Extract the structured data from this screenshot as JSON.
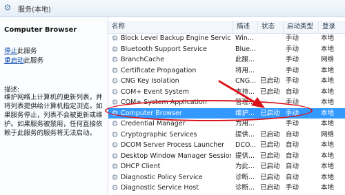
{
  "window": {
    "title": "服务(本地)"
  },
  "left_pane": {
    "service_name": "Computer Browser",
    "stop_link": "停止",
    "stop_suffix": "此服务",
    "restart_link": "重启动",
    "restart_suffix": "此服务",
    "description_label": "描述:",
    "description": "维护网络上计算机的更新列表，并将列表提供给计算机指定浏览。如果服务停止，列表不会被更新或维护。如果服务被禁用，任何直接依赖于此服务的服务将无法启动。"
  },
  "columns": [
    "名称",
    "描述",
    "状态",
    "启动类型",
    "登录"
  ],
  "rows": [
    {
      "name": "Block Level Backup Engine Service",
      "desc": "Win...",
      "status": "",
      "startup": "手动",
      "logon": "本地"
    },
    {
      "name": "Bluetooth Support Service",
      "desc": "Blue...",
      "status": "",
      "startup": "手动",
      "logon": "本地"
    },
    {
      "name": "BranchCache",
      "desc": "此服...",
      "status": "",
      "startup": "手动",
      "logon": "网络"
    },
    {
      "name": "Certificate Propagation",
      "desc": "将用...",
      "status": "",
      "startup": "手动",
      "logon": "本地"
    },
    {
      "name": "CNG Key Isolation",
      "desc": "CNG...",
      "status": "已启动",
      "startup": "手动",
      "logon": "本地"
    },
    {
      "name": "COM+ Event System",
      "desc": "支持...",
      "status": "已启动",
      "startup": "自动",
      "logon": "本地"
    },
    {
      "name": "COM+ System Application",
      "desc": "管理...",
      "status": "",
      "startup": "手动",
      "logon": "本地"
    },
    {
      "name": "Computer Browser",
      "desc": "维护...",
      "status": "已启动",
      "startup": "手动",
      "logon": "本地",
      "selected": true
    },
    {
      "name": "Credential Manager",
      "desc": "为用...",
      "status": "",
      "startup": "手动",
      "logon": "本地"
    },
    {
      "name": "Cryptographic Services",
      "desc": "提供...",
      "status": "已启动",
      "startup": "自动",
      "logon": "网络"
    },
    {
      "name": "DCOM Server Process Launcher",
      "desc": "DCO...",
      "status": "已启动",
      "startup": "自动",
      "logon": "本地"
    },
    {
      "name": "Desktop Window Manager Session ...",
      "desc": "提供...",
      "status": "已启动",
      "startup": "自动",
      "logon": "本地"
    },
    {
      "name": "DHCP Client",
      "desc": "为此...",
      "status": "已启动",
      "startup": "自动",
      "logon": "本地"
    },
    {
      "name": "Diagnostic Policy Service",
      "desc": "诊断...",
      "status": "已启动",
      "startup": "自动",
      "logon": "本地"
    },
    {
      "name": "Diagnostic Service Host",
      "desc": "诊断...",
      "status": "已启动",
      "startup": "手动",
      "logon": "本地"
    }
  ],
  "annotation": {
    "color": "#d9131a"
  }
}
